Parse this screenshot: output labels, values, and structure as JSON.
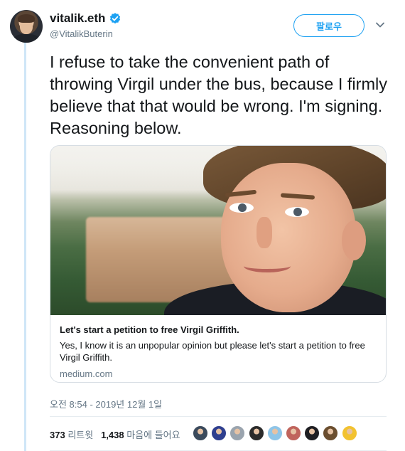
{
  "user": {
    "name": "vitalik.eth",
    "handle": "@VitalikButerin"
  },
  "header": {
    "follow_label": "팔로우"
  },
  "tweet": {
    "text": "I refuse to take the convenient path of throwing Virgil under the bus, because I firmly believe that that would be wrong. I'm signing. Reasoning below."
  },
  "card": {
    "title": "Let's start a petition to free Virgil Griffith.",
    "description": "Yes, I know it is an unpopular opinion but please let's start a petition to free Virgil Griffith.",
    "domain": "medium.com"
  },
  "timestamp": "오전 8:54 - 2019년 12월 1일",
  "stats": {
    "retweets_count": "373",
    "retweets_label": "리트윗",
    "likes_count": "1,438",
    "likes_label": "마음에 들어요"
  },
  "likers": [
    {
      "icon": "liker-avatar-1",
      "color": "#3b4a5c"
    },
    {
      "icon": "liker-avatar-2",
      "color": "#2f3f8f"
    },
    {
      "icon": "liker-avatar-3",
      "color": "#9aa4ae"
    },
    {
      "icon": "liker-avatar-4",
      "color": "#2b2b2b"
    },
    {
      "icon": "liker-avatar-5",
      "color": "#8ec5e8"
    },
    {
      "icon": "liker-avatar-6",
      "color": "#c0645c"
    },
    {
      "icon": "liker-avatar-7",
      "color": "#1e1e22"
    },
    {
      "icon": "liker-avatar-8",
      "color": "#6b4e2f"
    },
    {
      "icon": "liker-avatar-9",
      "color": "#f2c230"
    }
  ],
  "colors": {
    "accent": "#1da1f2",
    "muted": "#657786",
    "thread_line": "#cfe6f7"
  }
}
